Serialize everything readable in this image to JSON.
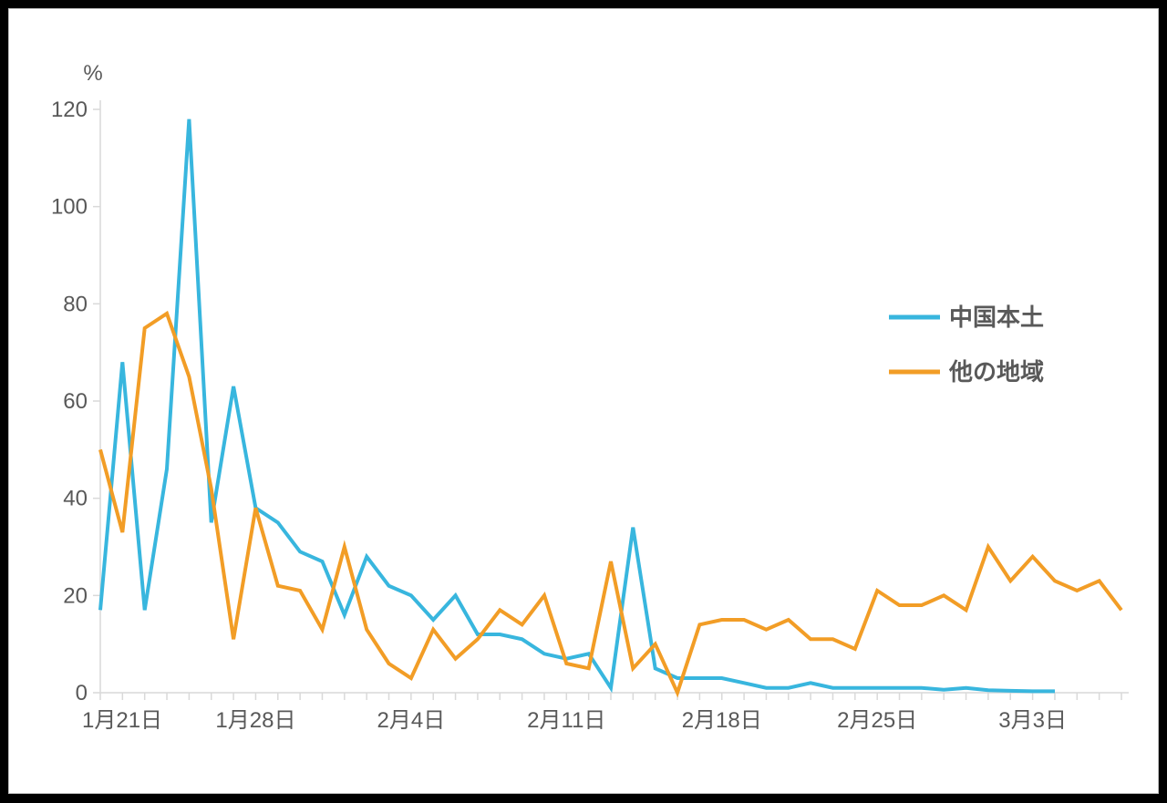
{
  "chart_data": {
    "type": "line",
    "ylabel": "%",
    "ylim": [
      0,
      120
    ],
    "yticks": [
      0,
      20,
      40,
      60,
      80,
      100,
      120
    ],
    "x_tick_labels": [
      "1月21日",
      "1月28日",
      "2月4日",
      "2月11日",
      "2月18日",
      "2月25日",
      "3月3日"
    ],
    "x_tick_indices": [
      0,
      7,
      14,
      21,
      28,
      35,
      42
    ],
    "colors": {
      "中国本土": "#38b6de",
      "他の地域": "#f29d26"
    },
    "legend_position": "right",
    "series": [
      {
        "name": "中国本土",
        "values": [
          17,
          68,
          17,
          46,
          118,
          35,
          63,
          38,
          35,
          29,
          27,
          16,
          28,
          22,
          20,
          15,
          20,
          12,
          12,
          11,
          8,
          7,
          8,
          1,
          34,
          5,
          3,
          3,
          3,
          2,
          1,
          1,
          2,
          1,
          1,
          1,
          1,
          1,
          0.6,
          1,
          0.5,
          0.4,
          0.3,
          0.3
        ]
      },
      {
        "name": "他の地域",
        "values": [
          50,
          33,
          75,
          78,
          65,
          42,
          11,
          38,
          22,
          21,
          13,
          30,
          13,
          6,
          3,
          13,
          7,
          11,
          17,
          14,
          20,
          6,
          5,
          27,
          5,
          10,
          0,
          14,
          15,
          15,
          13,
          15,
          11,
          11,
          9,
          21,
          18,
          18,
          20,
          17,
          30,
          23,
          28,
          23,
          21,
          23,
          17
        ]
      }
    ]
  },
  "legend": {
    "items": [
      {
        "label": "中国本土"
      },
      {
        "label": "他の地域"
      }
    ]
  },
  "axes": {
    "y_unit": "%",
    "x_ticks": [
      "1月21日",
      "1月28日",
      "2月4日",
      "2月11日",
      "2月18日",
      "2月25日",
      "3月3日"
    ]
  }
}
